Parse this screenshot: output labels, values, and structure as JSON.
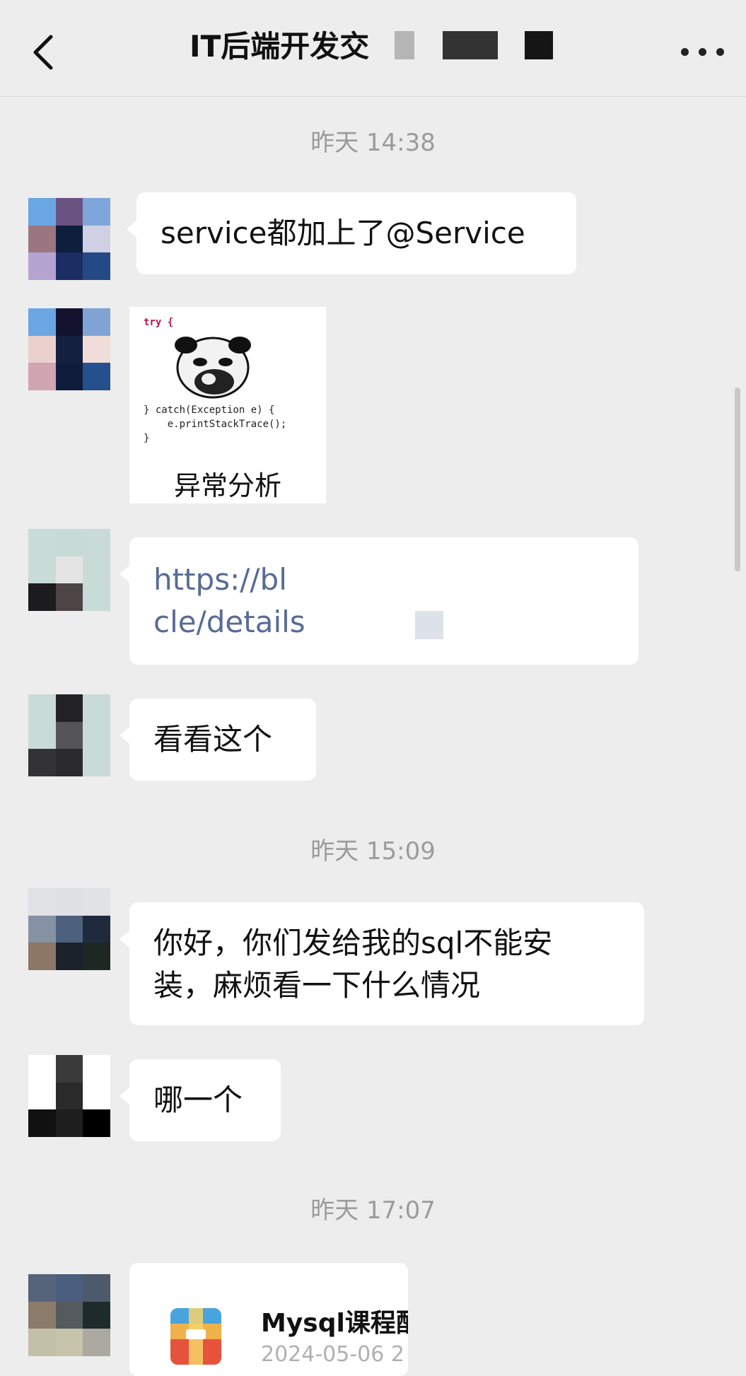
{
  "header": {
    "title": "IT后端开发交",
    "back_icon": "chevron-left-icon",
    "more_icon": "more-horizontal-icon"
  },
  "timestamps": [
    "昨天 14:38",
    "昨天 15:09",
    "昨天 17:07"
  ],
  "messages": [
    {
      "text": "service都加上了@Service"
    },
    {
      "caption": "异常分析",
      "code": [
        "try {",
        "} catch(Exception e) {",
        "    e.printStackTrace();",
        "}"
      ]
    },
    {
      "link_lines": [
        "https://bl",
        "cle/details"
      ]
    },
    {
      "text": "看看这个"
    },
    {
      "lines": [
        "你好，你们发给我的sql不能安",
        "装，麻烦看一下什么情况"
      ]
    },
    {
      "text": "哪一个"
    },
    {
      "file_name": "Mysql课程配",
      "file_date": "2024-05-06 2"
    }
  ],
  "colors": {
    "background": "#ededed",
    "bubble": "#ffffff",
    "link": "#576b95",
    "timestamp": "#9b9b9b"
  }
}
